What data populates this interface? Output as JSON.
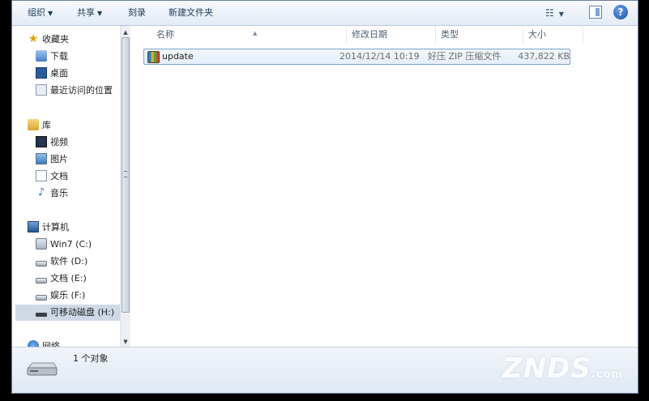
{
  "toolbar": {
    "organize": "组织",
    "share": "共享",
    "burn": "刻录",
    "new_folder": "新建文件夹",
    "help": "?"
  },
  "nav": {
    "favorites": {
      "label": "收藏夹",
      "items": [
        {
          "label": "下载",
          "icon": "downloads-icon"
        },
        {
          "label": "桌面",
          "icon": "desktop-icon"
        },
        {
          "label": "最近访问的位置",
          "icon": "recent-places-icon"
        }
      ]
    },
    "libraries": {
      "label": "库",
      "items": [
        {
          "label": "视频",
          "icon": "video-icon"
        },
        {
          "label": "图片",
          "icon": "picture-icon"
        },
        {
          "label": "文档",
          "icon": "document-icon"
        },
        {
          "label": "音乐",
          "icon": "music-icon"
        }
      ]
    },
    "computer": {
      "label": "计算机",
      "items": [
        {
          "label": "Win7 (C:)",
          "icon": "system-drive-icon"
        },
        {
          "label": "软件 (D:)",
          "icon": "drive-icon"
        },
        {
          "label": "文档 (E:)",
          "icon": "drive-icon"
        },
        {
          "label": "娱乐 (F:)",
          "icon": "drive-icon"
        },
        {
          "label": "可移动磁盘 (H:)",
          "icon": "usb-drive-icon",
          "selected": true
        }
      ]
    },
    "network": {
      "label": "网络"
    }
  },
  "columns": [
    "名称",
    "修改日期",
    "类型",
    "大小"
  ],
  "files": [
    {
      "name": "update",
      "modified": "2014/12/14 10:19",
      "type": "好压 ZIP 压缩文件",
      "size": "437,822 KB"
    }
  ],
  "status": {
    "text": "1 个对象"
  },
  "watermark": {
    "main": "ZNDS",
    "sub": ".com"
  }
}
